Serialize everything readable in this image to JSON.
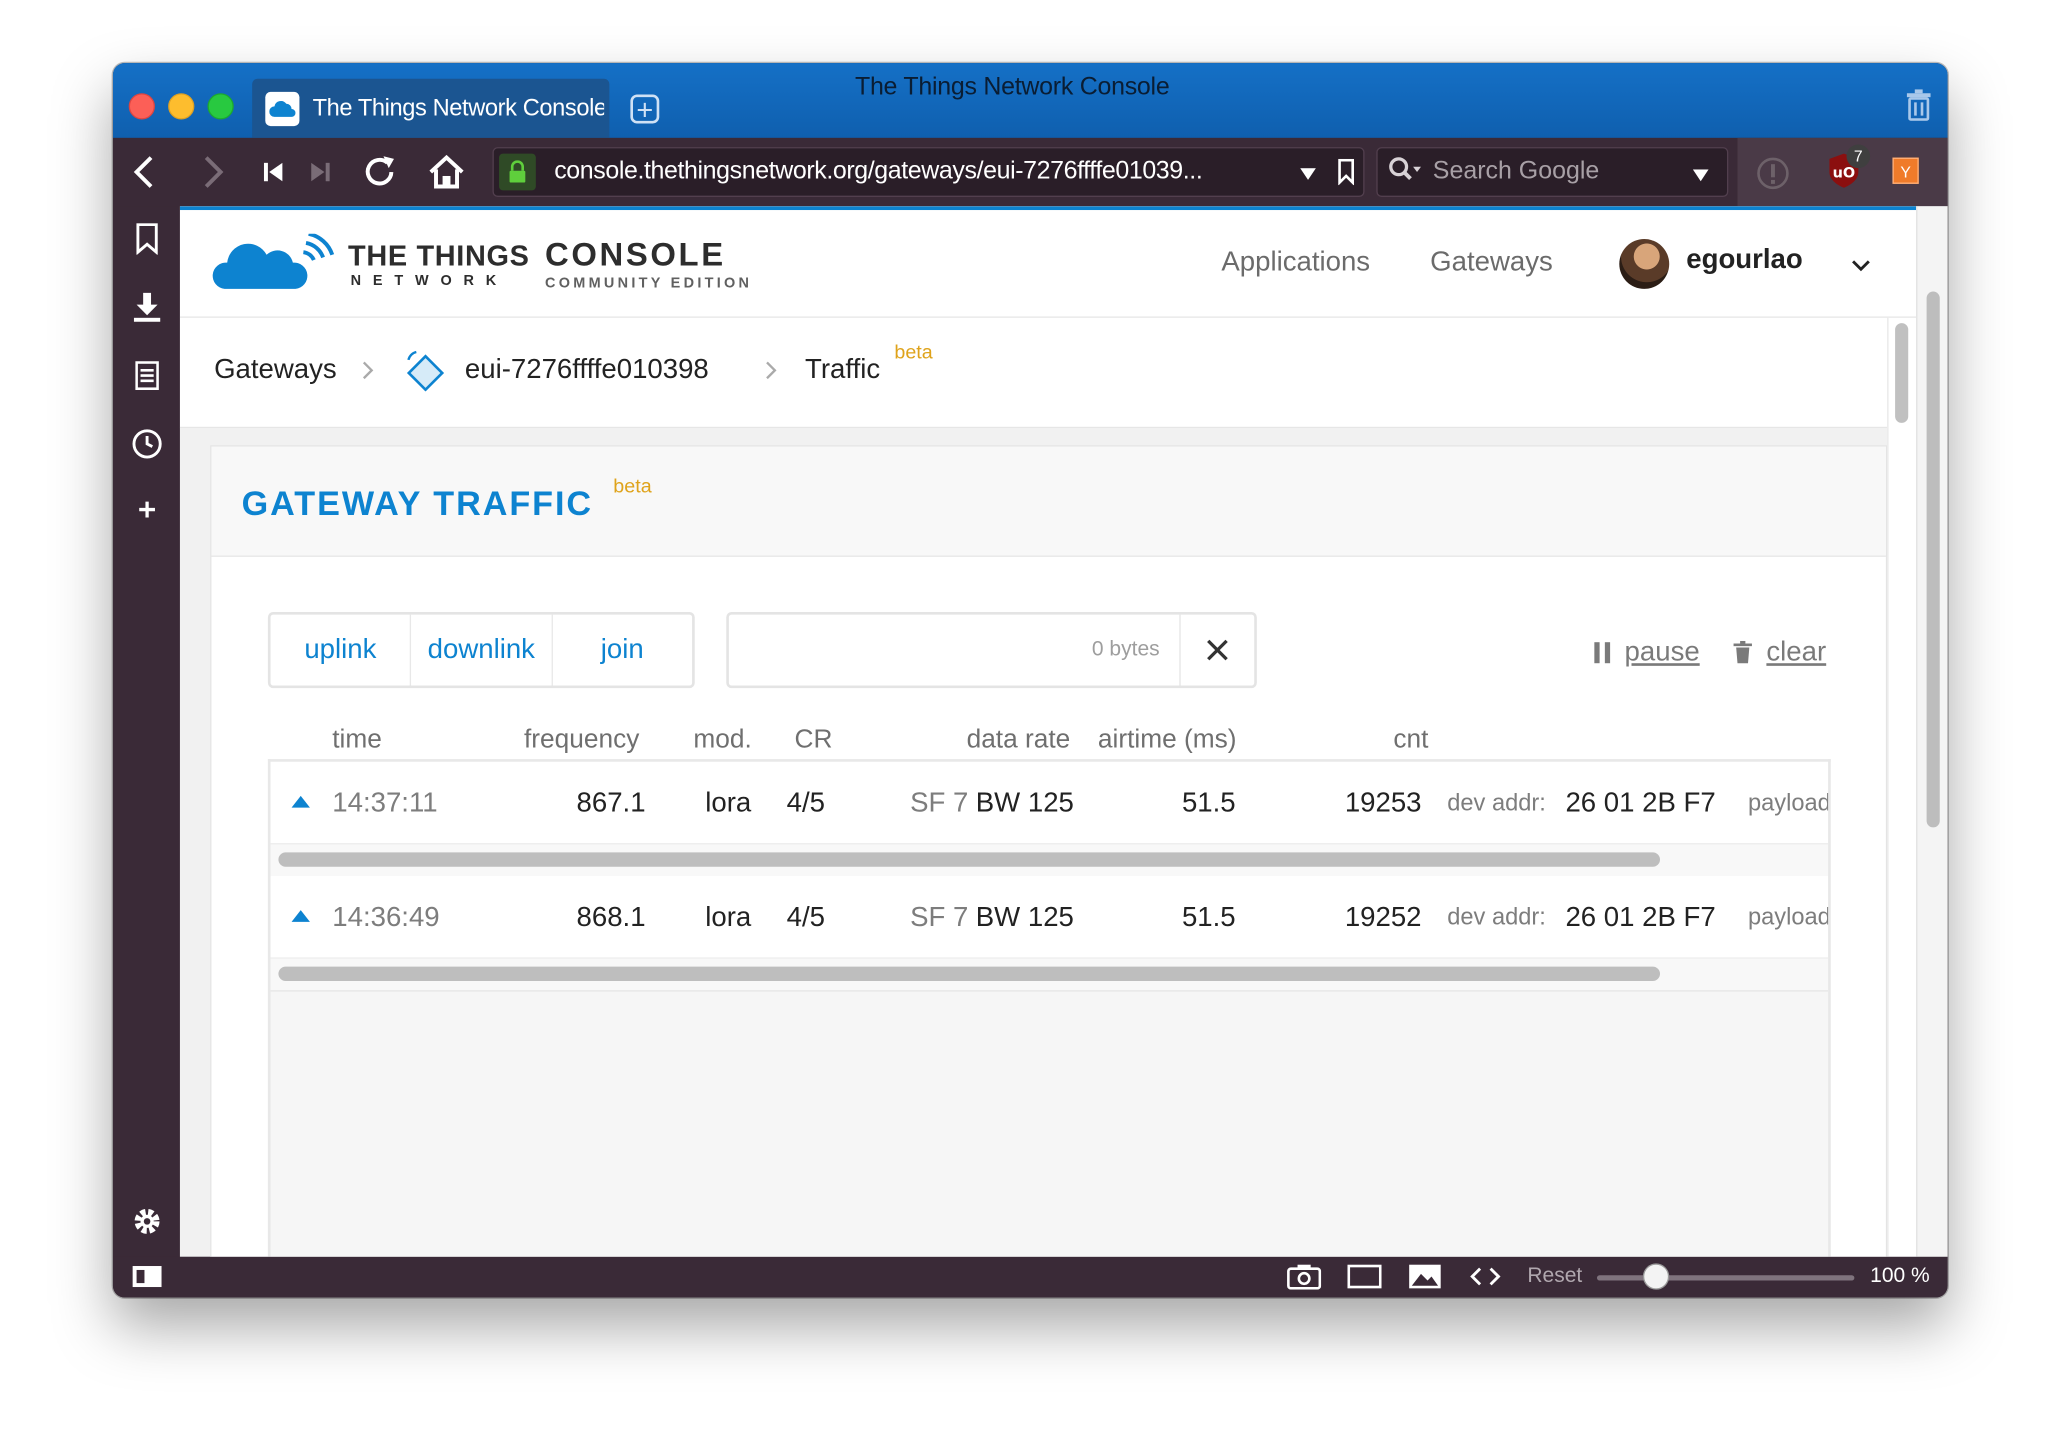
{
  "browser": {
    "tab_title": "The Things Network Console",
    "window_title": "The Things Network Console",
    "url": "console.thethingsnetwork.org/gateways/eui-7276ffffe01039...",
    "search_placeholder": "Search Google",
    "ublock_count": "7",
    "zoom_reset_label": "Reset",
    "zoom_level": "100 %",
    "zoom_fraction": 0.2
  },
  "header": {
    "brand_line1": "THE THINGS",
    "brand_line2": "NETWORK",
    "brand_console": "CONSOLE",
    "brand_edition": "COMMUNITY EDITION",
    "nav": [
      "Applications",
      "Gateways"
    ],
    "username": "egourlao"
  },
  "breadcrumb": {
    "root": "Gateways",
    "gateway": "eui-7276ffffe010398",
    "page": "Traffic",
    "badge": "beta"
  },
  "traffic": {
    "title": "GATEWAY TRAFFIC",
    "badge": "beta",
    "filters": [
      "uplink",
      "downlink",
      "join"
    ],
    "bytes_placeholder": "0 bytes",
    "pause_label": "pause",
    "clear_label": "clear",
    "columns": {
      "time": "time",
      "frequency": "frequency",
      "mod": "mod.",
      "cr": "CR",
      "data_rate": "data rate",
      "airtime": "airtime (ms)",
      "cnt": "cnt"
    },
    "rows": [
      {
        "time": "14:37:11",
        "frequency": "867.1",
        "mod": "lora",
        "cr": "4/5",
        "sf": "SF 7",
        "bw": "BW 125",
        "airtime": "51.5",
        "cnt": "19253",
        "dev_addr_label": "dev addr:",
        "dev_addr": "26 01 2B F7",
        "payload_label": "payload"
      },
      {
        "time": "14:36:49",
        "frequency": "868.1",
        "mod": "lora",
        "cr": "4/5",
        "sf": "SF 7",
        "bw": "BW 125",
        "airtime": "51.5",
        "cnt": "19252",
        "dev_addr_label": "dev addr:",
        "dev_addr": "26 01 2B F7",
        "payload_label": "payload"
      }
    ]
  },
  "colors": {
    "accent": "#0d83d0",
    "beta": "#dfa31b",
    "browser_chrome": "#3a2a37",
    "tabbar": "#1570c6"
  }
}
